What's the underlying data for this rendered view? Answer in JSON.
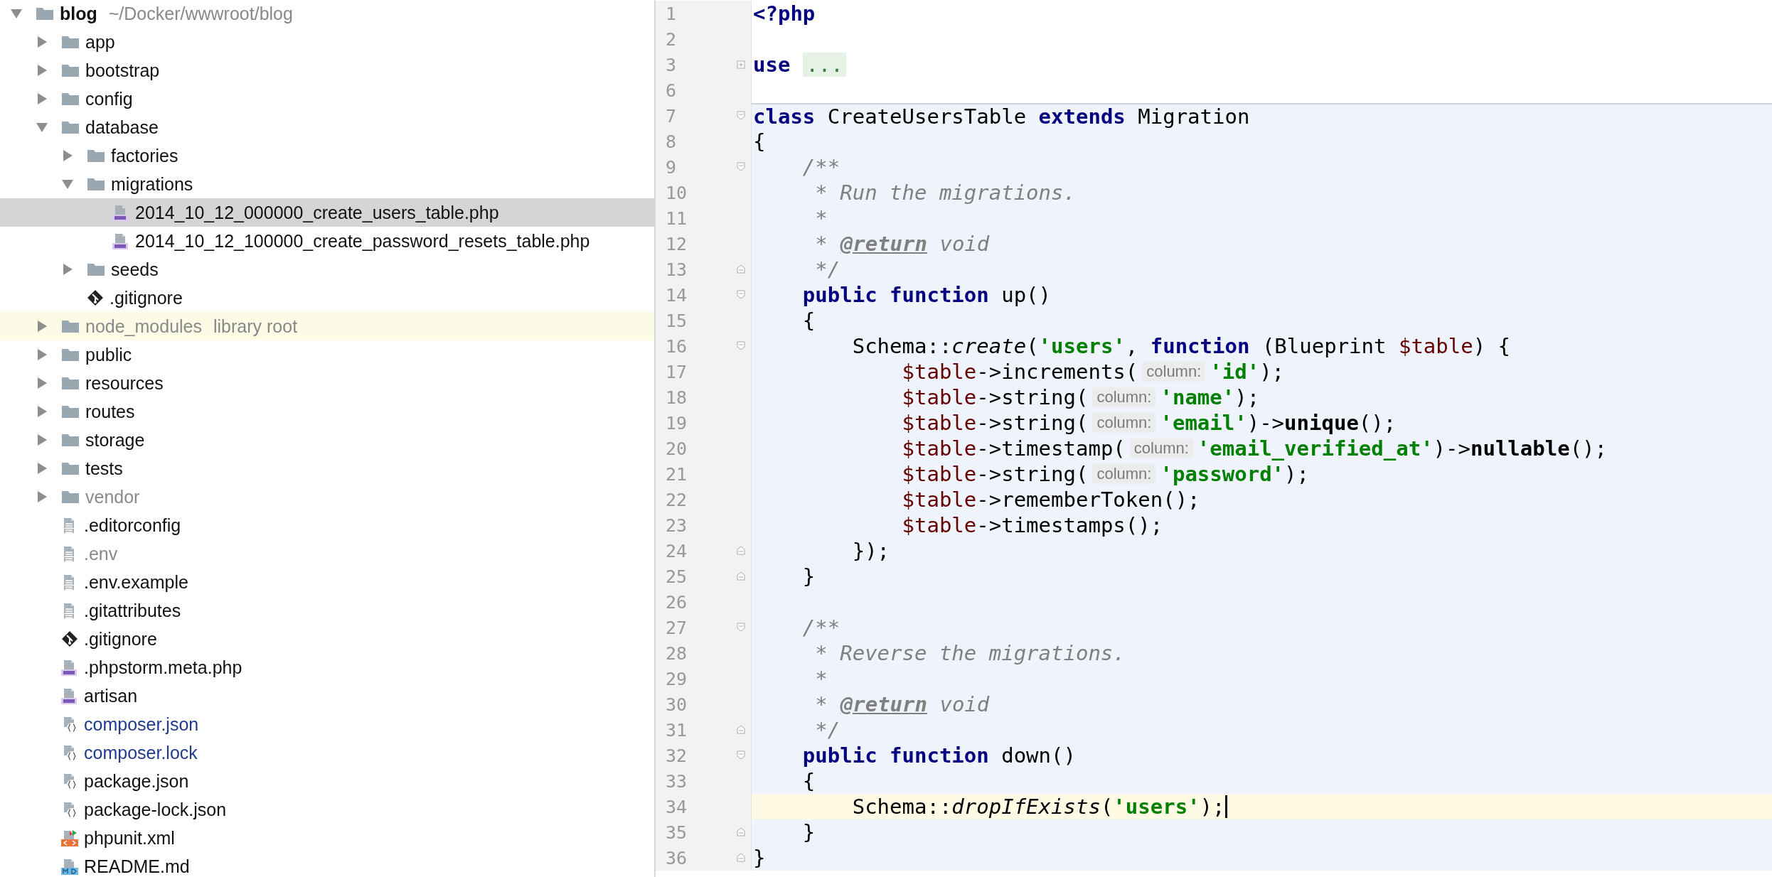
{
  "project_tree": {
    "root": {
      "name": "blog",
      "detail": "~/Docker/wwwroot/blog",
      "kind": "folder",
      "expanded": true,
      "selected": false,
      "dimmed": false,
      "modified": false,
      "library": false,
      "children": [
        {
          "name": "app",
          "kind": "folder",
          "expanded": false,
          "selected": false,
          "dimmed": false,
          "modified": false,
          "library": false
        },
        {
          "name": "bootstrap",
          "kind": "folder",
          "expanded": false,
          "selected": false,
          "dimmed": false,
          "modified": false,
          "library": false
        },
        {
          "name": "config",
          "kind": "folder",
          "expanded": false,
          "selected": false,
          "dimmed": false,
          "modified": false,
          "library": false
        },
        {
          "name": "database",
          "kind": "folder",
          "expanded": true,
          "selected": false,
          "dimmed": false,
          "modified": false,
          "library": false,
          "children": [
            {
              "name": "factories",
              "kind": "folder",
              "expanded": false,
              "selected": false,
              "dimmed": false,
              "modified": false,
              "library": false
            },
            {
              "name": "migrations",
              "kind": "folder",
              "expanded": true,
              "selected": false,
              "dimmed": false,
              "modified": false,
              "library": false,
              "children": [
                {
                  "name": "2014_10_12_000000_create_users_table.php",
                  "kind": "php",
                  "selected": true,
                  "dimmed": false,
                  "modified": false,
                  "library": false
                },
                {
                  "name": "2014_10_12_100000_create_password_resets_table.php",
                  "kind": "php",
                  "selected": false,
                  "dimmed": false,
                  "modified": false,
                  "library": false
                }
              ]
            },
            {
              "name": "seeds",
              "kind": "folder",
              "expanded": false,
              "selected": false,
              "dimmed": false,
              "modified": false,
              "library": false
            },
            {
              "name": ".gitignore",
              "kind": "git",
              "selected": false,
              "dimmed": false,
              "modified": false,
              "library": false
            }
          ]
        },
        {
          "name": "node_modules",
          "detail": "library root",
          "kind": "folder",
          "expanded": false,
          "selected": false,
          "dimmed": true,
          "modified": false,
          "library": true
        },
        {
          "name": "public",
          "kind": "folder",
          "expanded": false,
          "selected": false,
          "dimmed": false,
          "modified": false,
          "library": false
        },
        {
          "name": "resources",
          "kind": "folder",
          "expanded": false,
          "selected": false,
          "dimmed": false,
          "modified": false,
          "library": false
        },
        {
          "name": "routes",
          "kind": "folder",
          "expanded": false,
          "selected": false,
          "dimmed": false,
          "modified": false,
          "library": false
        },
        {
          "name": "storage",
          "kind": "folder",
          "expanded": false,
          "selected": false,
          "dimmed": false,
          "modified": false,
          "library": false
        },
        {
          "name": "tests",
          "kind": "folder",
          "expanded": false,
          "selected": false,
          "dimmed": false,
          "modified": false,
          "library": false
        },
        {
          "name": "vendor",
          "kind": "folder",
          "expanded": false,
          "selected": false,
          "dimmed": true,
          "modified": false,
          "library": false
        },
        {
          "name": ".editorconfig",
          "kind": "text",
          "selected": false,
          "dimmed": false,
          "modified": false,
          "library": false
        },
        {
          "name": ".env",
          "kind": "text",
          "selected": false,
          "dimmed": true,
          "modified": false,
          "library": false
        },
        {
          "name": ".env.example",
          "kind": "text",
          "selected": false,
          "dimmed": false,
          "modified": false,
          "library": false
        },
        {
          "name": ".gitattributes",
          "kind": "text",
          "selected": false,
          "dimmed": false,
          "modified": false,
          "library": false
        },
        {
          "name": ".gitignore",
          "kind": "git",
          "selected": false,
          "dimmed": false,
          "modified": false,
          "library": false
        },
        {
          "name": ".phpstorm.meta.php",
          "kind": "php",
          "selected": false,
          "dimmed": false,
          "modified": false,
          "library": false
        },
        {
          "name": "artisan",
          "kind": "php",
          "selected": false,
          "dimmed": false,
          "modified": false,
          "library": false
        },
        {
          "name": "composer.json",
          "kind": "json",
          "selected": false,
          "dimmed": false,
          "modified": true,
          "library": false
        },
        {
          "name": "composer.lock",
          "kind": "json",
          "selected": false,
          "dimmed": false,
          "modified": true,
          "library": false
        },
        {
          "name": "package.json",
          "kind": "json",
          "selected": false,
          "dimmed": false,
          "modified": false,
          "library": false
        },
        {
          "name": "package-lock.json",
          "kind": "json",
          "selected": false,
          "dimmed": false,
          "modified": false,
          "library": false
        },
        {
          "name": "phpunit.xml",
          "kind": "xml",
          "selected": false,
          "dimmed": false,
          "modified": false,
          "library": false
        },
        {
          "name": "README.md",
          "kind": "md",
          "selected": false,
          "dimmed": false,
          "modified": false,
          "library": false
        }
      ]
    }
  },
  "editor": {
    "lines": [
      {
        "number": "1",
        "kind": "plain",
        "scoped": false,
        "separator": false,
        "current": false,
        "caret": false,
        "tokens": [
          {
            "kind": "keyword",
            "text": "<?php"
          }
        ]
      },
      {
        "number": "2",
        "kind": "plain",
        "scoped": false,
        "separator": false,
        "current": false,
        "caret": false
      },
      {
        "number": "3",
        "kind": "folded",
        "scoped": false,
        "separator": false,
        "current": false,
        "caret": false,
        "tokens": [
          {
            "kind": "keyword",
            "text": "use"
          },
          {
            "kind": "folded",
            "text": "..."
          }
        ]
      },
      {
        "number": "6",
        "kind": "plain",
        "scoped": false,
        "separator": false,
        "current": false,
        "caret": false
      },
      {
        "number": "7",
        "kind": "fold-start",
        "scoped": true,
        "separator": true,
        "current": false,
        "caret": false,
        "tokens": [
          {
            "kind": "keyword",
            "text": "class"
          },
          {
            "kind": "plain",
            "text": " CreateUsersTable "
          },
          {
            "kind": "keyword",
            "text": "extends"
          },
          {
            "kind": "plain",
            "text": " Migration"
          }
        ]
      },
      {
        "number": "8",
        "kind": "plain",
        "scoped": true,
        "separator": false,
        "current": false,
        "caret": false,
        "tokens": [
          {
            "kind": "plain",
            "text": "{"
          }
        ]
      },
      {
        "number": "9",
        "kind": "fold-start",
        "scoped": true,
        "separator": false,
        "current": false,
        "caret": false,
        "tokens": [
          {
            "kind": "comment",
            "text": "    /**"
          }
        ]
      },
      {
        "number": "10",
        "kind": "plain",
        "scoped": true,
        "separator": false,
        "current": false,
        "caret": false,
        "tokens": [
          {
            "kind": "comment",
            "text": "     * Run the migrations."
          }
        ]
      },
      {
        "number": "11",
        "kind": "plain",
        "scoped": true,
        "separator": false,
        "current": false,
        "caret": false,
        "tokens": [
          {
            "kind": "comment",
            "text": "     *"
          }
        ]
      },
      {
        "number": "12",
        "kind": "plain",
        "scoped": true,
        "separator": false,
        "current": false,
        "caret": false,
        "tokens": [
          {
            "kind": "comment",
            "text": "     *"
          },
          {
            "kind": "doctag",
            "text": "@return"
          },
          {
            "kind": "comment",
            "text": " void"
          }
        ]
      },
      {
        "number": "13",
        "kind": "fold-end",
        "scoped": true,
        "separator": false,
        "current": false,
        "caret": false,
        "tokens": [
          {
            "kind": "comment",
            "text": "     */"
          }
        ]
      },
      {
        "number": "14",
        "kind": "fold-start",
        "scoped": true,
        "separator": false,
        "current": false,
        "caret": false,
        "tokens": [
          {
            "kind": "keyword",
            "text": "    public function"
          },
          {
            "kind": "plain",
            "text": " up()"
          }
        ]
      },
      {
        "number": "15",
        "kind": "plain",
        "scoped": true,
        "separator": false,
        "current": false,
        "caret": false,
        "tokens": [
          {
            "kind": "plain",
            "text": "    {"
          }
        ]
      },
      {
        "number": "16",
        "kind": "fold-start",
        "scoped": true,
        "separator": false,
        "current": false,
        "caret": false,
        "tokens": [
          {
            "kind": "plain",
            "text": "        Schema::"
          },
          {
            "kind": "call",
            "text": "create"
          },
          {
            "kind": "plain",
            "text": "("
          },
          {
            "kind": "string",
            "text": "'users'"
          },
          {
            "kind": "plain",
            "text": ", "
          },
          {
            "kind": "keyword",
            "text": "function"
          },
          {
            "kind": "plain",
            "text": " (Blueprint "
          },
          {
            "kind": "variable",
            "text": "$table"
          },
          {
            "kind": "plain",
            "text": ") {"
          }
        ]
      },
      {
        "number": "17",
        "kind": "plain",
        "scoped": true,
        "separator": false,
        "current": false,
        "caret": false,
        "tokens": [
          {
            "kind": "variable",
            "text": "            $table"
          },
          {
            "kind": "plain",
            "text": "->increments("
          },
          {
            "kind": "hint",
            "text": "column:"
          },
          {
            "kind": "string",
            "text": "'id'"
          },
          {
            "kind": "plain",
            "text": ");"
          }
        ]
      },
      {
        "number": "18",
        "kind": "plain",
        "scoped": true,
        "separator": false,
        "current": false,
        "caret": false,
        "tokens": [
          {
            "kind": "variable",
            "text": "            $table"
          },
          {
            "kind": "plain",
            "text": "->string("
          },
          {
            "kind": "hint",
            "text": "column:"
          },
          {
            "kind": "string",
            "text": "'name'"
          },
          {
            "kind": "plain",
            "text": ");"
          }
        ]
      },
      {
        "number": "19",
        "kind": "plain",
        "scoped": true,
        "separator": false,
        "current": false,
        "caret": false,
        "tokens": [
          {
            "kind": "variable",
            "text": "            $table"
          },
          {
            "kind": "plain",
            "text": "->string("
          },
          {
            "kind": "hint",
            "text": "column:"
          },
          {
            "kind": "string",
            "text": "'email'"
          },
          {
            "kind": "plain",
            "text": ")->"
          },
          {
            "kind": "method",
            "text": "unique"
          },
          {
            "kind": "plain",
            "text": "();"
          }
        ]
      },
      {
        "number": "20",
        "kind": "plain",
        "scoped": true,
        "separator": false,
        "current": false,
        "caret": false,
        "tokens": [
          {
            "kind": "variable",
            "text": "            $table"
          },
          {
            "kind": "plain",
            "text": "->timestamp("
          },
          {
            "kind": "hint",
            "text": "column:"
          },
          {
            "kind": "string",
            "text": "'email_verified_at'"
          },
          {
            "kind": "plain",
            "text": ")->"
          },
          {
            "kind": "method",
            "text": "nullable"
          },
          {
            "kind": "plain",
            "text": "();"
          }
        ]
      },
      {
        "number": "21",
        "kind": "plain",
        "scoped": true,
        "separator": false,
        "current": false,
        "caret": false,
        "tokens": [
          {
            "kind": "variable",
            "text": "            $table"
          },
          {
            "kind": "plain",
            "text": "->string("
          },
          {
            "kind": "hint",
            "text": "column:"
          },
          {
            "kind": "string",
            "text": "'password'"
          },
          {
            "kind": "plain",
            "text": ");"
          }
        ]
      },
      {
        "number": "22",
        "kind": "plain",
        "scoped": true,
        "separator": false,
        "current": false,
        "caret": false,
        "tokens": [
          {
            "kind": "variable",
            "text": "            $table"
          },
          {
            "kind": "plain",
            "text": "->rememberToken();"
          }
        ]
      },
      {
        "number": "23",
        "kind": "plain",
        "scoped": true,
        "separator": false,
        "current": false,
        "caret": false,
        "tokens": [
          {
            "kind": "variable",
            "text": "            $table"
          },
          {
            "kind": "plain",
            "text": "->timestamps();"
          }
        ]
      },
      {
        "number": "24",
        "kind": "fold-end",
        "scoped": true,
        "separator": false,
        "current": false,
        "caret": false,
        "tokens": [
          {
            "kind": "plain",
            "text": "        });"
          }
        ]
      },
      {
        "number": "25",
        "kind": "fold-end",
        "scoped": true,
        "separator": false,
        "current": false,
        "caret": false,
        "tokens": [
          {
            "kind": "plain",
            "text": "    }"
          }
        ]
      },
      {
        "number": "26",
        "kind": "plain",
        "scoped": true,
        "separator": false,
        "current": false,
        "caret": false
      },
      {
        "number": "27",
        "kind": "fold-start",
        "scoped": true,
        "separator": false,
        "current": false,
        "caret": false,
        "tokens": [
          {
            "kind": "comment",
            "text": "    /**"
          }
        ]
      },
      {
        "number": "28",
        "kind": "plain",
        "scoped": true,
        "separator": false,
        "current": false,
        "caret": false,
        "tokens": [
          {
            "kind": "comment",
            "text": "     * Reverse the migrations."
          }
        ]
      },
      {
        "number": "29",
        "kind": "plain",
        "scoped": true,
        "separator": false,
        "current": false,
        "caret": false,
        "tokens": [
          {
            "kind": "comment",
            "text": "     *"
          }
        ]
      },
      {
        "number": "30",
        "kind": "plain",
        "scoped": true,
        "separator": false,
        "current": false,
        "caret": false,
        "tokens": [
          {
            "kind": "comment",
            "text": "     *"
          },
          {
            "kind": "doctag",
            "text": "@return"
          },
          {
            "kind": "comment",
            "text": " void"
          }
        ]
      },
      {
        "number": "31",
        "kind": "fold-end",
        "scoped": true,
        "separator": false,
        "current": false,
        "caret": false,
        "tokens": [
          {
            "kind": "comment",
            "text": "     */"
          }
        ]
      },
      {
        "number": "32",
        "kind": "fold-start",
        "scoped": true,
        "separator": false,
        "current": false,
        "caret": false,
        "tokens": [
          {
            "kind": "keyword",
            "text": "    public function"
          },
          {
            "kind": "plain",
            "text": " down()"
          }
        ]
      },
      {
        "number": "33",
        "kind": "plain",
        "scoped": true,
        "separator": false,
        "current": false,
        "caret": false,
        "tokens": [
          {
            "kind": "plain",
            "text": "    {"
          }
        ]
      },
      {
        "number": "34",
        "kind": "plain",
        "scoped": true,
        "separator": false,
        "current": true,
        "caret": true,
        "tokens": [
          {
            "kind": "plain",
            "text": "        Schema::"
          },
          {
            "kind": "call",
            "text": "dropIfExists"
          },
          {
            "kind": "plain",
            "text": "("
          },
          {
            "kind": "string",
            "text": "'users'"
          },
          {
            "kind": "plain",
            "text": ");"
          }
        ]
      },
      {
        "number": "35",
        "kind": "fold-end",
        "scoped": true,
        "separator": false,
        "current": false,
        "caret": false,
        "tokens": [
          {
            "kind": "plain",
            "text": "    }"
          }
        ]
      },
      {
        "number": "36",
        "kind": "fold-end",
        "scoped": true,
        "separator": false,
        "current": false,
        "caret": false,
        "tokens": [
          {
            "kind": "plain",
            "text": "}"
          }
        ]
      }
    ]
  }
}
